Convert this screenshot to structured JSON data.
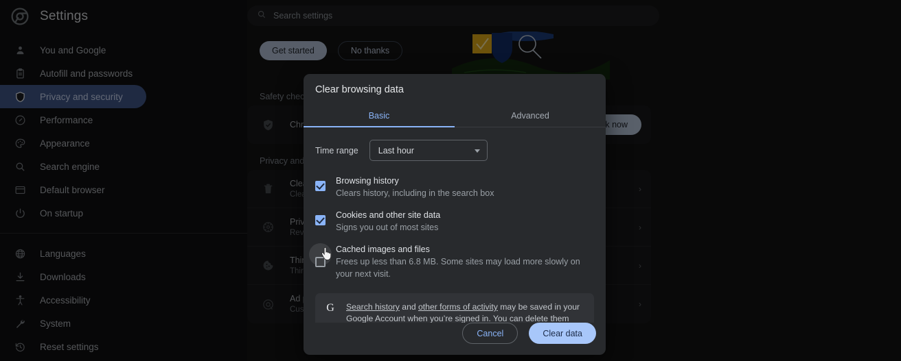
{
  "app": {
    "title": "Settings",
    "logo_icon": "chrome-logo-icon"
  },
  "search": {
    "placeholder": "Search settings",
    "icon": "search-icon"
  },
  "sidebar": {
    "items": [
      {
        "label": "You and Google",
        "icon": "person-icon",
        "selected": false
      },
      {
        "label": "Autofill and passwords",
        "icon": "clipboard-icon",
        "selected": false
      },
      {
        "label": "Privacy and security",
        "icon": "shield-icon",
        "selected": true
      },
      {
        "label": "Performance",
        "icon": "speedometer-icon",
        "selected": false
      },
      {
        "label": "Appearance",
        "icon": "palette-icon",
        "selected": false
      },
      {
        "label": "Search engine",
        "icon": "magnifier-icon",
        "selected": false
      },
      {
        "label": "Default browser",
        "icon": "browser-window-icon",
        "selected": false
      },
      {
        "label": "On startup",
        "icon": "power-icon",
        "selected": false
      }
    ],
    "items2": [
      {
        "label": "Languages",
        "icon": "globe-icon"
      },
      {
        "label": "Downloads",
        "icon": "download-icon"
      },
      {
        "label": "Accessibility",
        "icon": "accessibility-icon"
      },
      {
        "label": "System",
        "icon": "wrench-icon"
      },
      {
        "label": "Reset settings",
        "icon": "history-restore-icon"
      }
    ]
  },
  "hero": {
    "get_started_label": "Get started",
    "no_thanks_label": "No thanks"
  },
  "safety_check": {
    "section_label": "Safety check",
    "row_title": "Chrome",
    "button_label": "ck now"
  },
  "privacy": {
    "section_label": "Privacy and se",
    "rows": [
      {
        "icon": "trash-icon",
        "title": "Clear b",
        "sub": "Clear h",
        "chevron": "›"
      },
      {
        "icon": "privacy-guide-icon",
        "title": "Privacy",
        "sub": "Review",
        "chevron": "›"
      },
      {
        "icon": "cookie-icon",
        "title": "Third-",
        "sub": "Third-",
        "chevron": "›"
      },
      {
        "icon": "ad-privacy-icon",
        "title": "Ad pri",
        "sub": "Custom",
        "chevron": "›"
      }
    ]
  },
  "dialog": {
    "title": "Clear browsing data",
    "tabs": [
      {
        "label": "Basic",
        "active": true
      },
      {
        "label": "Advanced",
        "active": false
      }
    ],
    "time_range": {
      "label": "Time range",
      "value": "Last hour",
      "caret_icon": "chevron-down-icon"
    },
    "checkboxes": [
      {
        "title": "Browsing history",
        "desc": "Clears history, including in the search box",
        "checked": true
      },
      {
        "title": "Cookies and other site data",
        "desc": "Signs you out of most sites",
        "checked": true
      },
      {
        "title": "Cached images and files",
        "desc": "Frees up less than 6.8 MB. Some sites may load more slowly on your next visit.",
        "checked": false,
        "hovered": true
      }
    ],
    "google_note": {
      "logo_icon": "google-g-icon",
      "logo_letter": "G",
      "link1": "Search history",
      "mid": " and ",
      "link2": "other forms of activity",
      "tail": " may be saved in your Google Account when you’re signed in. You can delete them anytime."
    },
    "footer": {
      "cancel_label": "Cancel",
      "clear_label": "Clear data"
    }
  },
  "colors": {
    "accent_blue": "#8ab4f8",
    "button_blue": "#a8c7fa",
    "selected_nav": "#3f5585",
    "dialog_bg": "#282a2d",
    "page_bg": "#121212"
  }
}
